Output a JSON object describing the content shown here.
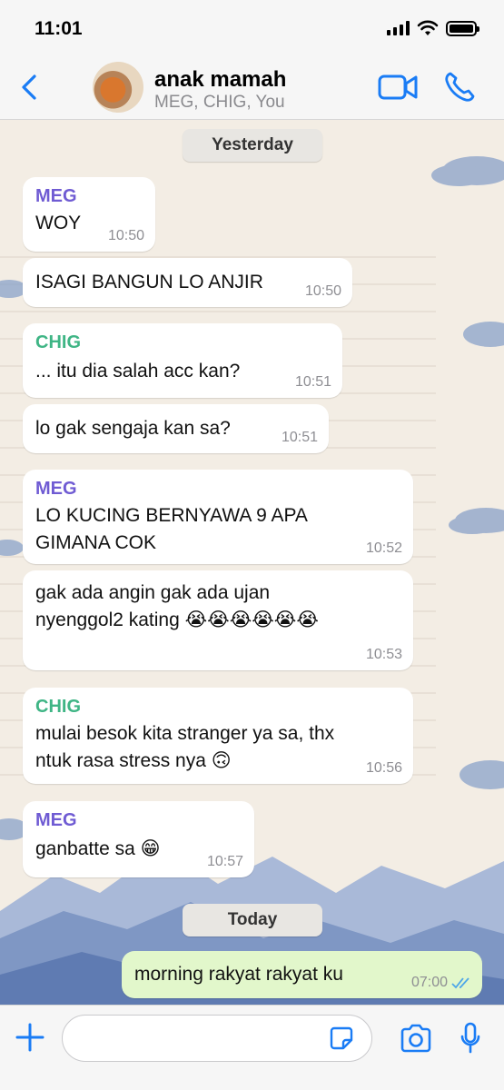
{
  "status_bar": {
    "time": "11:01"
  },
  "header": {
    "title": "anak mamah",
    "members": "MEG, CHIG, You",
    "icons": [
      "back-chevron-icon",
      "video-call-icon",
      "phone-icon"
    ]
  },
  "colors": {
    "accent": "#1a7cf5",
    "meg": "#6f5bd3",
    "chig": "#3fb585",
    "outgoing_bubble": "#e2f7cb",
    "read_ticks": "#4fa7e8"
  },
  "dates": {
    "yesterday": "Yesterday",
    "today": "Today"
  },
  "messages": [
    {
      "sender": "MEG",
      "text": "WOY",
      "time": "10:50"
    },
    {
      "sender": "",
      "text": "ISAGI BANGUN LO ANJIR",
      "time": "10:50"
    },
    {
      "sender": "CHIG",
      "text": "... itu dia salah acc kan?",
      "time": "10:51"
    },
    {
      "sender": "",
      "text": "lo gak sengaja kan sa?",
      "time": "10:51"
    },
    {
      "sender": "MEG",
      "text": "LO KUCING BERNYAWA 9 APA\nGIMANA COK",
      "time": "10:52"
    },
    {
      "sender": "",
      "text": "gak ada angin gak ada ujan\nnyenggol2 kating 😭😭😭😭😭😭",
      "time": "10:53"
    },
    {
      "sender": "CHIG",
      "text": "mulai besok kita stranger ya sa, thx\nntuk rasa stress nya 🙃",
      "time": "10:56"
    },
    {
      "sender": "MEG",
      "text": "ganbatte sa 😁",
      "time": "10:57"
    },
    {
      "sender": "You",
      "text": "morning rakyat rakyat ku",
      "time": "07:00"
    }
  ],
  "input": {
    "value": "",
    "placeholder": ""
  }
}
